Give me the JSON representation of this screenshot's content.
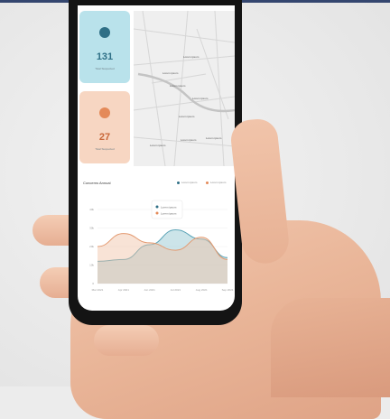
{
  "stats": [
    {
      "value": "131",
      "label": "Total Suspected",
      "icon": "car-icon",
      "color": "#2f6f86",
      "bg": "#b9e2eb"
    },
    {
      "value": "27",
      "label": "Total Suspected",
      "icon": "person-icon",
      "color": "#e48a59",
      "bg": "#f7d6c2"
    }
  ],
  "map": {
    "labels": [
      "Lorem ipsum",
      "Lorem ipsum",
      "Lorem ipsum",
      "Lorem ipsum",
      "Lorem ipsum",
      "Lorem ipsum",
      "Lorem ipsum",
      "Lorem ipsum"
    ]
  },
  "chart": {
    "title": "Concerns Annual",
    "legend": [
      {
        "name": "Lorem ipsum",
        "color": "#2f6f86"
      },
      {
        "name": "Lorem ipsum",
        "color": "#e48a59"
      }
    ],
    "tooltip": [
      "Lorem ipsum",
      "Lorem ipsum"
    ]
  },
  "chart_data": {
    "type": "area",
    "title": "Concerns Annual",
    "x": [
      "Mar 2021",
      "Apr 2021",
      "Jun 2021",
      "Jul 2021",
      "Aug 2021",
      "Sep 2021"
    ],
    "y_ticks": [
      "40k",
      "30k",
      "20k",
      "10k",
      "0"
    ],
    "series": [
      {
        "name": "Lorem ipsum",
        "color": "#8fc3cf",
        "values": [
          12,
          13,
          21,
          29,
          24,
          14
        ]
      },
      {
        "name": "Lorem ipsum",
        "color": "#efc0a4",
        "values": [
          20,
          27,
          22,
          18,
          25,
          13
        ]
      }
    ]
  }
}
